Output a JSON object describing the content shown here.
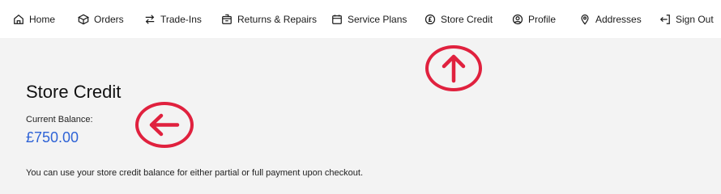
{
  "nav": {
    "items": [
      {
        "label": "Home",
        "icon": "home-icon"
      },
      {
        "label": "Orders",
        "icon": "box-icon"
      },
      {
        "label": "Trade-Ins",
        "icon": "swap-arrows-icon"
      },
      {
        "label": "Returns & Repairs",
        "icon": "return-box-icon"
      },
      {
        "label": "Service Plans",
        "icon": "calendar-icon"
      },
      {
        "label": "Store Credit",
        "icon": "pound-coin-icon"
      },
      {
        "label": "Profile",
        "icon": "user-circle-icon"
      },
      {
        "label": "Addresses",
        "icon": "location-pin-icon"
      },
      {
        "label": "Sign Out",
        "icon": "sign-out-icon"
      }
    ]
  },
  "page": {
    "title": "Store Credit",
    "balance_label": "Current Balance:",
    "balance_value": "£750.00",
    "info": "You can use your store credit balance for either partial or full payment upon checkout."
  },
  "annotations": {
    "color": "#e0213e",
    "arrows": [
      "arrow-up-annotation",
      "arrow-left-annotation"
    ]
  },
  "colors": {
    "accent": "#2f63d6",
    "background": "#f3f3f3",
    "nav_background": "#ffffff"
  }
}
